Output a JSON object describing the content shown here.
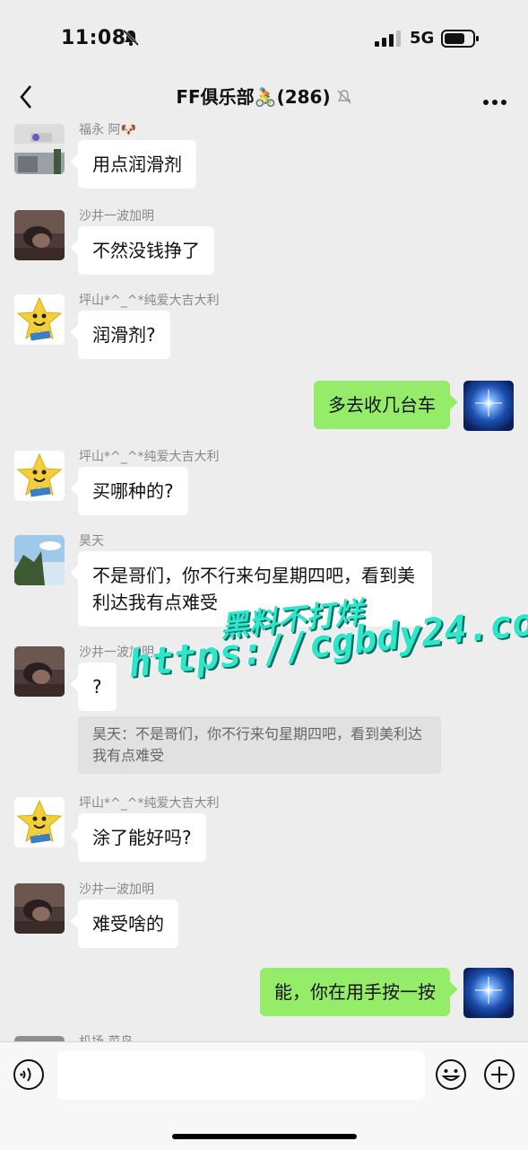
{
  "status": {
    "time": "11:08",
    "network": "5G"
  },
  "header": {
    "title": "FF俱乐部🚴(286)"
  },
  "messages": [
    {
      "sender": "福永 阿🐶",
      "text": "用点润滑剂"
    },
    {
      "sender": "沙井一波加明",
      "text": "不然没钱挣了"
    },
    {
      "sender": "坪山*^_^*纯爱大吉大利",
      "text": "润滑剂?"
    },
    {
      "text": "多去收几台车"
    },
    {
      "sender": "坪山*^_^*纯爱大吉大利",
      "text": "买哪种的?"
    },
    {
      "sender": "昊天",
      "text": "不是哥们，你不行来句星期四吧，看到美利达我有点难受"
    },
    {
      "sender": "沙井一波加明",
      "text": "?",
      "quote": "昊天：不是哥们，你不行来句星期四吧，看到美利达我有点难受"
    },
    {
      "sender": "坪山*^_^*纯爱大吉大利",
      "text": "涂了能好吗?"
    },
    {
      "sender": "沙井一波加明",
      "text": "难受啥的"
    },
    {
      "text": "能，你在用手按一按"
    },
    {
      "sender": "机场 菜鸟"
    }
  ],
  "watermark": {
    "line1": "黑料不打烊",
    "line2": "https://cgbdy24.com"
  },
  "colors": {
    "background": "#ededed",
    "outgoing_bubble": "#95ec69",
    "incoming_bubble": "#ffffff"
  },
  "icons": [
    "bell-off-icon",
    "signal-icon",
    "battery-icon",
    "back-arrow-icon",
    "mute-icon",
    "more-icon",
    "voice-icon",
    "emoji-icon",
    "plus-icon"
  ]
}
